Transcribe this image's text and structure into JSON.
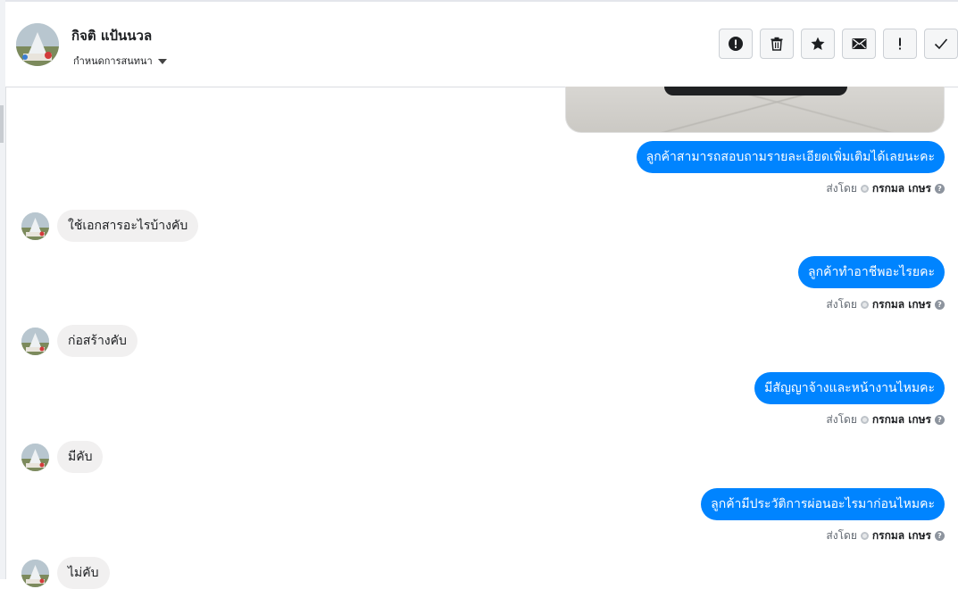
{
  "header": {
    "contact_name": "กิจติ แป้นนวล",
    "assign_label": "กำหนดการสนทนา"
  },
  "actions": [
    {
      "name": "report-button",
      "icon": "exclamation-circle-icon"
    },
    {
      "name": "delete-button",
      "icon": "trash-icon"
    },
    {
      "name": "star-button",
      "icon": "star-icon"
    },
    {
      "name": "mark-unread-button",
      "icon": "envelope-icon"
    },
    {
      "name": "follow-up-button",
      "icon": "exclamation-icon"
    },
    {
      "name": "mark-done-button",
      "icon": "checkmark-icon"
    }
  ],
  "colors": {
    "outgoing_bubble": "#0084ff",
    "incoming_bubble": "#f1f0f0"
  },
  "sent_by": {
    "label": "ส่งโดย",
    "name": "กรกมล เกษร",
    "help": "?"
  },
  "messages": [
    {
      "direction": "out",
      "text": "ลูกค้าสามารถสอบถามรายละเอียดเพิ่มเติมได้เลยนะคะ"
    },
    {
      "direction": "in",
      "text": "ใช้เอกสารอะไรบ้างคับ"
    },
    {
      "direction": "out",
      "text": "ลูกค้าทำอาชีพอะไรยคะ"
    },
    {
      "direction": "in",
      "text": "ก่อสร้างคับ"
    },
    {
      "direction": "out",
      "text": "มีสัญญาจ้างและหน้างานไหมคะ"
    },
    {
      "direction": "in",
      "text": "มีคับ"
    },
    {
      "direction": "out",
      "text": "ลูกค้ามีประวัติการผ่อนอะไรมาก่อนไหมคะ"
    },
    {
      "direction": "in",
      "text": "ไม่คับ"
    }
  ]
}
